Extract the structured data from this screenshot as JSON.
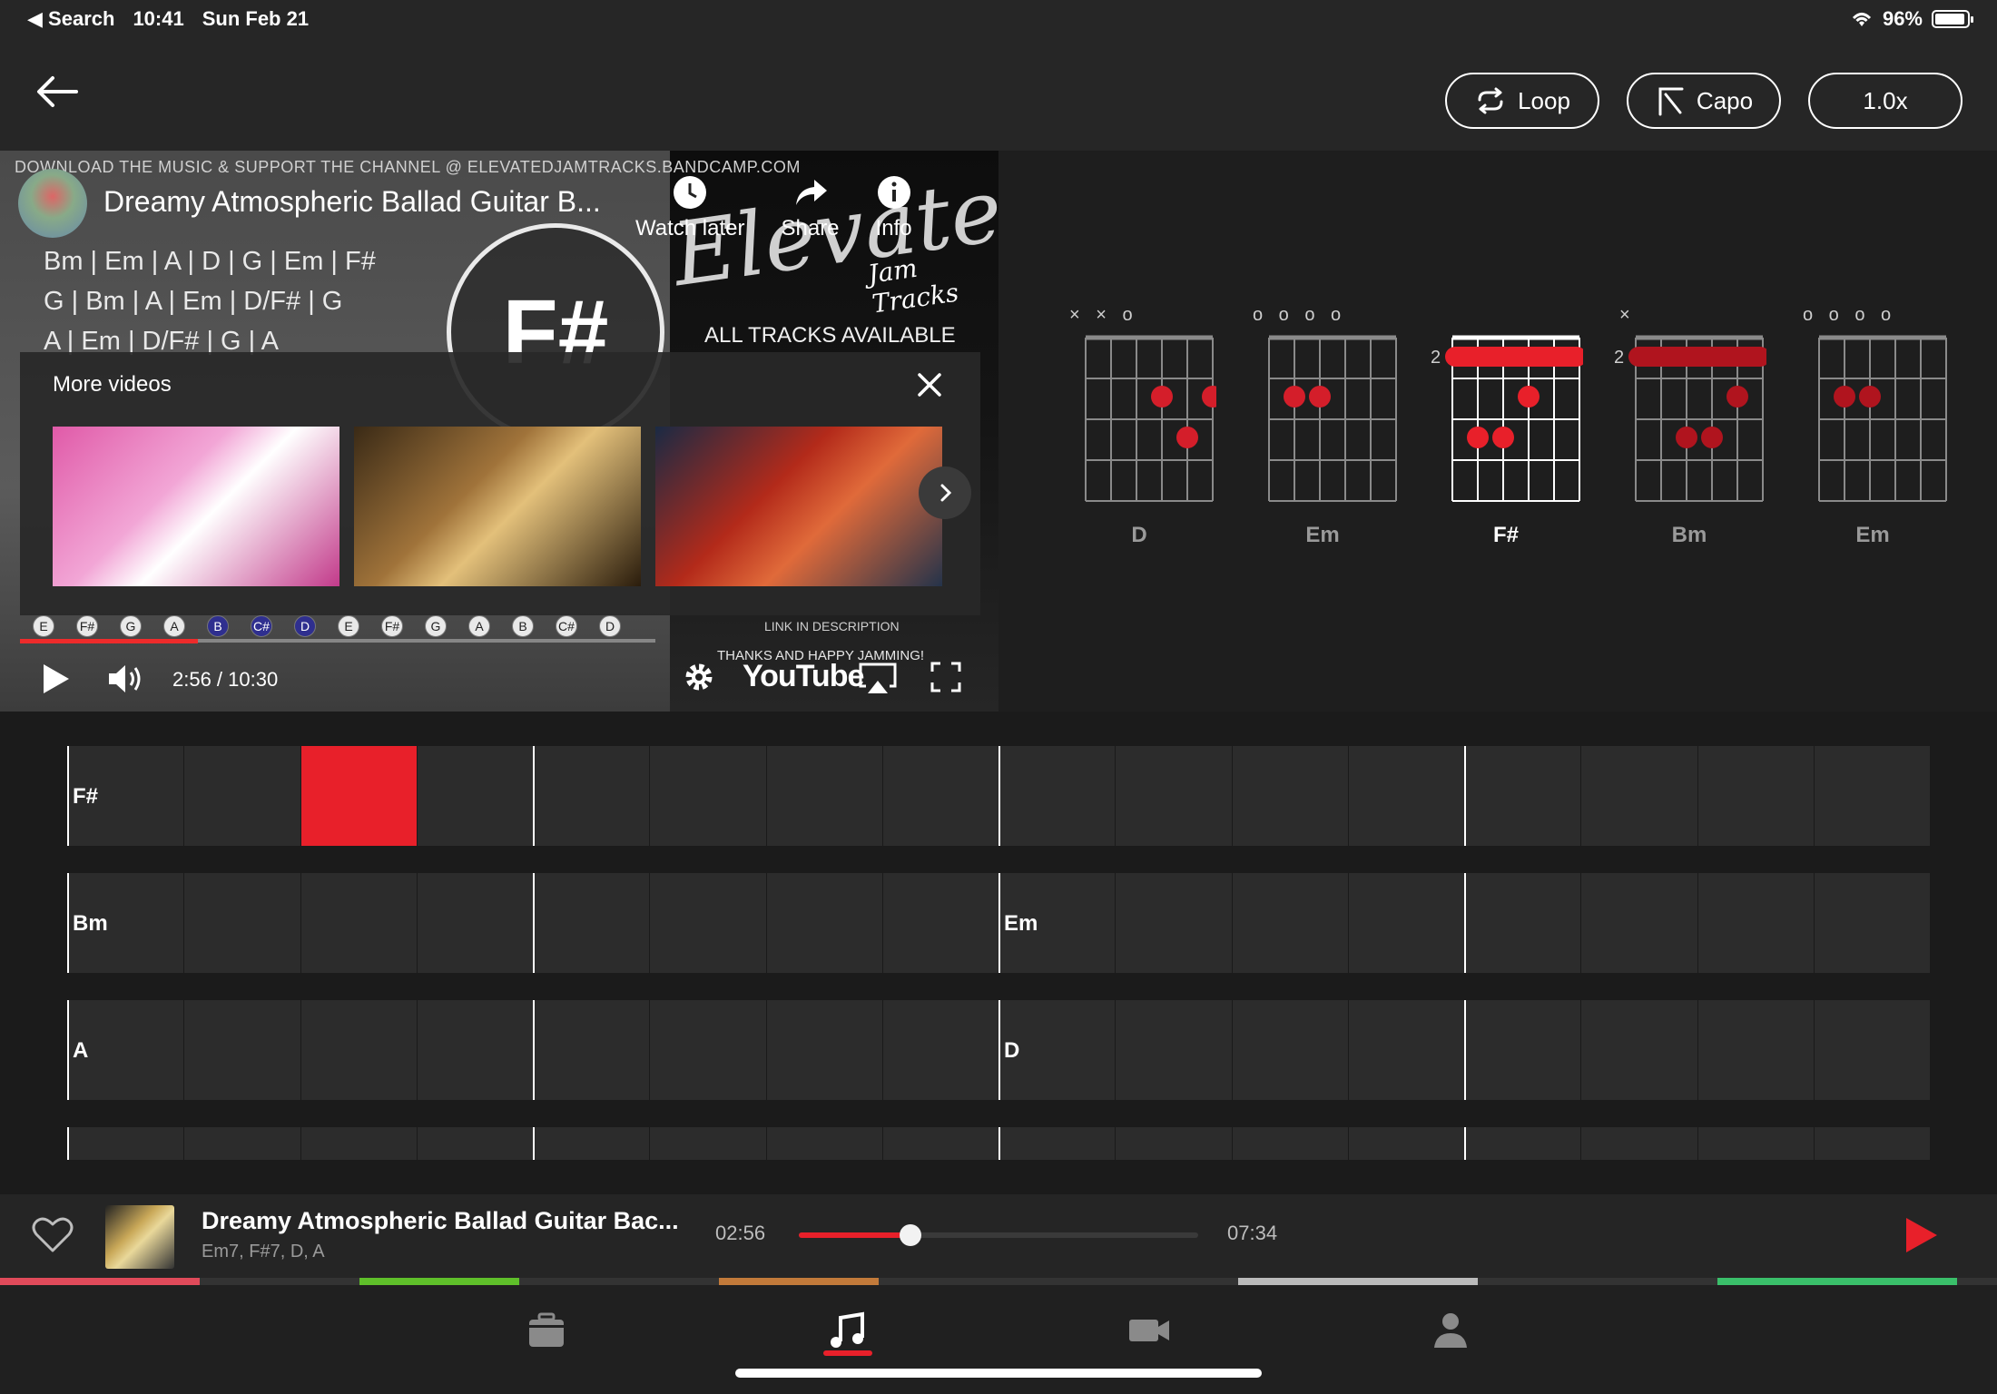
{
  "status_bar": {
    "back_app": "Search",
    "time": "10:41",
    "date": "Sun Feb 21",
    "battery": "96%"
  },
  "header": {
    "loop_label": "Loop",
    "capo_label": "Capo",
    "speed_label": "1.0x"
  },
  "video": {
    "banner": "DOWNLOAD THE MUSIC & SUPPORT THE CHANNEL @ ELEVATEDJAMTRACKS.BANDCAMP.COM",
    "title": "Dreamy Atmospheric Ballad Guitar B...",
    "chords_lines": [
      "Bm | Em | A | D | G | Em | F#",
      "G | Bm | A | Em | D/F# | G",
      "A | Em | D/F# | G | A"
    ],
    "current_chord": "F#",
    "watch_later": "Watch later",
    "share": "Share",
    "info": "Info",
    "brand": "Elevated",
    "brand_sub": "Jam Tracks",
    "available": "ALL TRACKS AVAILABLE",
    "more_videos": "More videos",
    "link_desc": "LINK IN DESCRIPTION",
    "thanks": "THANKS AND HAPPY JAMMING!",
    "time": "2:56 / 10:30",
    "youtube": "YouTube",
    "progress": 0.28
  },
  "fret_notes": [
    "E",
    "F#",
    "G",
    "A",
    "B",
    "C#",
    "D",
    "E",
    "F#",
    "G",
    "A",
    "B",
    "C#",
    "D"
  ],
  "diagrams": [
    {
      "name": "D",
      "markers": "× × o",
      "active": false
    },
    {
      "name": "Em",
      "markers": "o    o o o",
      "active": false
    },
    {
      "name": "F#",
      "markers": "",
      "fret": "2",
      "active": true
    },
    {
      "name": "Bm",
      "markers": "×",
      "fret": "2",
      "active": false
    },
    {
      "name": "Em",
      "markers": "o    o o o",
      "active": false
    }
  ],
  "grid": {
    "rows": [
      {
        "chords": [
          {
            "cell": 0,
            "name": "F#"
          }
        ],
        "active_cell": 2
      },
      {
        "chords": [
          {
            "cell": 0,
            "name": "Bm"
          },
          {
            "cell": 8,
            "name": "Em"
          }
        ]
      },
      {
        "chords": [
          {
            "cell": 0,
            "name": "A"
          },
          {
            "cell": 8,
            "name": "D"
          }
        ]
      },
      {
        "chords": []
      }
    ]
  },
  "now_playing": {
    "title": "Dreamy Atmospheric Ballad Guitar Bac...",
    "chords": "Em7, F#7, D, A",
    "elapsed": "02:56",
    "total": "07:34",
    "progress": 0.28
  },
  "colors": {
    "accent": "#e8202a",
    "background": "#1f1f1f",
    "cell": "#2c2c2c"
  }
}
